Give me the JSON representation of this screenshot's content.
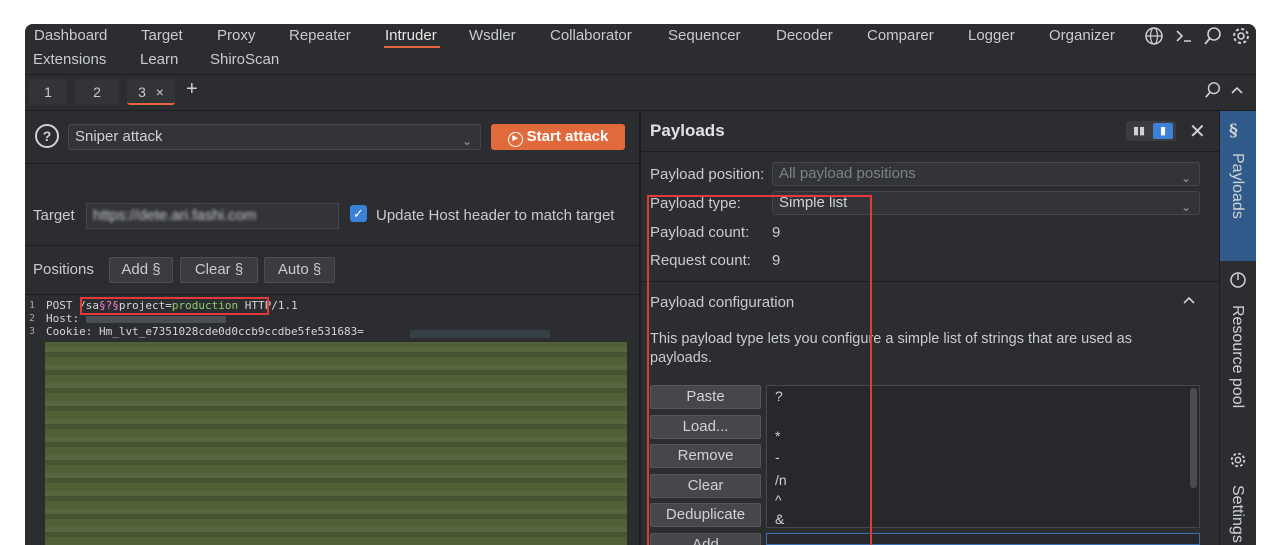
{
  "menu": {
    "items": [
      "Dashboard",
      "Target",
      "Proxy",
      "Repeater",
      "Intruder",
      "Wsdler",
      "Collaborator",
      "Sequencer",
      "Decoder",
      "Comparer",
      "Logger",
      "Organizer"
    ],
    "items_row2": [
      "Extensions",
      "Learn",
      "ShiroScan"
    ],
    "active": "Intruder",
    "icons": [
      "globe-icon",
      "terminal-icon",
      "search-icon",
      "settings-icon"
    ]
  },
  "tabs": {
    "items": [
      "1",
      "2",
      "3"
    ],
    "close": "×",
    "add": "+",
    "active": "3"
  },
  "left": {
    "attack_type": "Sniper attack",
    "start_attack": "Start attack",
    "target_label": "Target",
    "target_value": "https://dete.ari.fashi.com",
    "update_host_label": "Update Host header to match target",
    "update_host_checked": true,
    "positions_label": "Positions",
    "add_btn": "Add §",
    "clear_btn": "Clear §",
    "auto_btn": "Auto §",
    "request": {
      "line_numbers": [
        "1",
        "2",
        "3"
      ],
      "line1_method": "POST ",
      "line1_path_a": "/sa",
      "line1_marker": "§?§",
      "line1_path_b": "project=",
      "line1_value": "production",
      "line1_proto": " HTTP/1.1",
      "line2": "Host: ",
      "line3": "Cookie: Hm_lvt_e7351028cde0d0ccb9ccdbe5fe531683="
    }
  },
  "right": {
    "title": "Payloads",
    "payload_position_label": "Payload position:",
    "payload_position_value": "All payload positions",
    "payload_type_label": "Payload type:",
    "payload_type_value": "Simple list",
    "payload_count_label": "Payload count:",
    "payload_count_value": "9",
    "request_count_label": "Request count:",
    "request_count_value": "9",
    "config_title": "Payload configuration",
    "config_desc": "This payload type lets you configure a simple list of strings that are used as payloads.",
    "buttons": [
      "Paste",
      "Load...",
      "Remove",
      "Clear",
      "Deduplicate",
      "Add"
    ],
    "list": [
      "?",
      "",
      "*",
      "-",
      "/n",
      "^",
      "&"
    ]
  },
  "side_tabs": {
    "payloads": "Payloads",
    "resource_pool": "Resource pool",
    "settings": "Settings"
  },
  "colors": {
    "accent": "#e8643c",
    "start_button": "#e06a3b",
    "checkbox": "#3b82d6",
    "highlight_box": "#e23a3a"
  }
}
